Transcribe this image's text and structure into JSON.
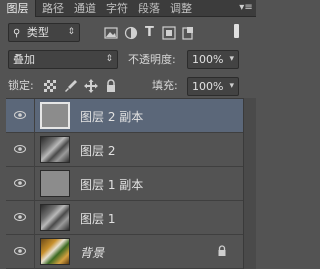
{
  "tabs": [
    {
      "label": "图层",
      "active": true
    },
    {
      "label": "路径"
    },
    {
      "label": "通道"
    },
    {
      "label": "字符"
    },
    {
      "label": "段落"
    },
    {
      "label": "调整"
    }
  ],
  "panel_menu_icon": "panel-menu-icon",
  "filter": {
    "icon": "search-icon",
    "value": "类型"
  },
  "filter_icons": [
    "image-filter-icon",
    "adjustment-filter-icon",
    "text-filter-icon",
    "shape-filter-icon",
    "smart-object-filter-icon",
    "filter-toggle-icon"
  ],
  "blend": {
    "value": "叠加",
    "opacity_label": "不透明度:",
    "opacity_value": "100%"
  },
  "lock": {
    "label": "锁定:",
    "fill_label": "填充:",
    "fill_value": "100%",
    "icons": [
      "lock-transparent-icon",
      "lock-paint-icon",
      "lock-move-icon",
      "lock-all-icon"
    ]
  },
  "layers": [
    {
      "name": "图层 2 副本",
      "thumb": "gray",
      "selected": true
    },
    {
      "name": "图层 2",
      "thumb": "photo"
    },
    {
      "name": "图层 1 副本",
      "thumb": "gray"
    },
    {
      "name": "图层 1",
      "thumb": "photo"
    },
    {
      "name": "背景",
      "thumb": "color",
      "italic": true,
      "locked": true
    }
  ],
  "colors": {
    "panel_bg": "#535353",
    "selected_row": "#5b6779",
    "tab_bg": "#3c3c3c"
  }
}
